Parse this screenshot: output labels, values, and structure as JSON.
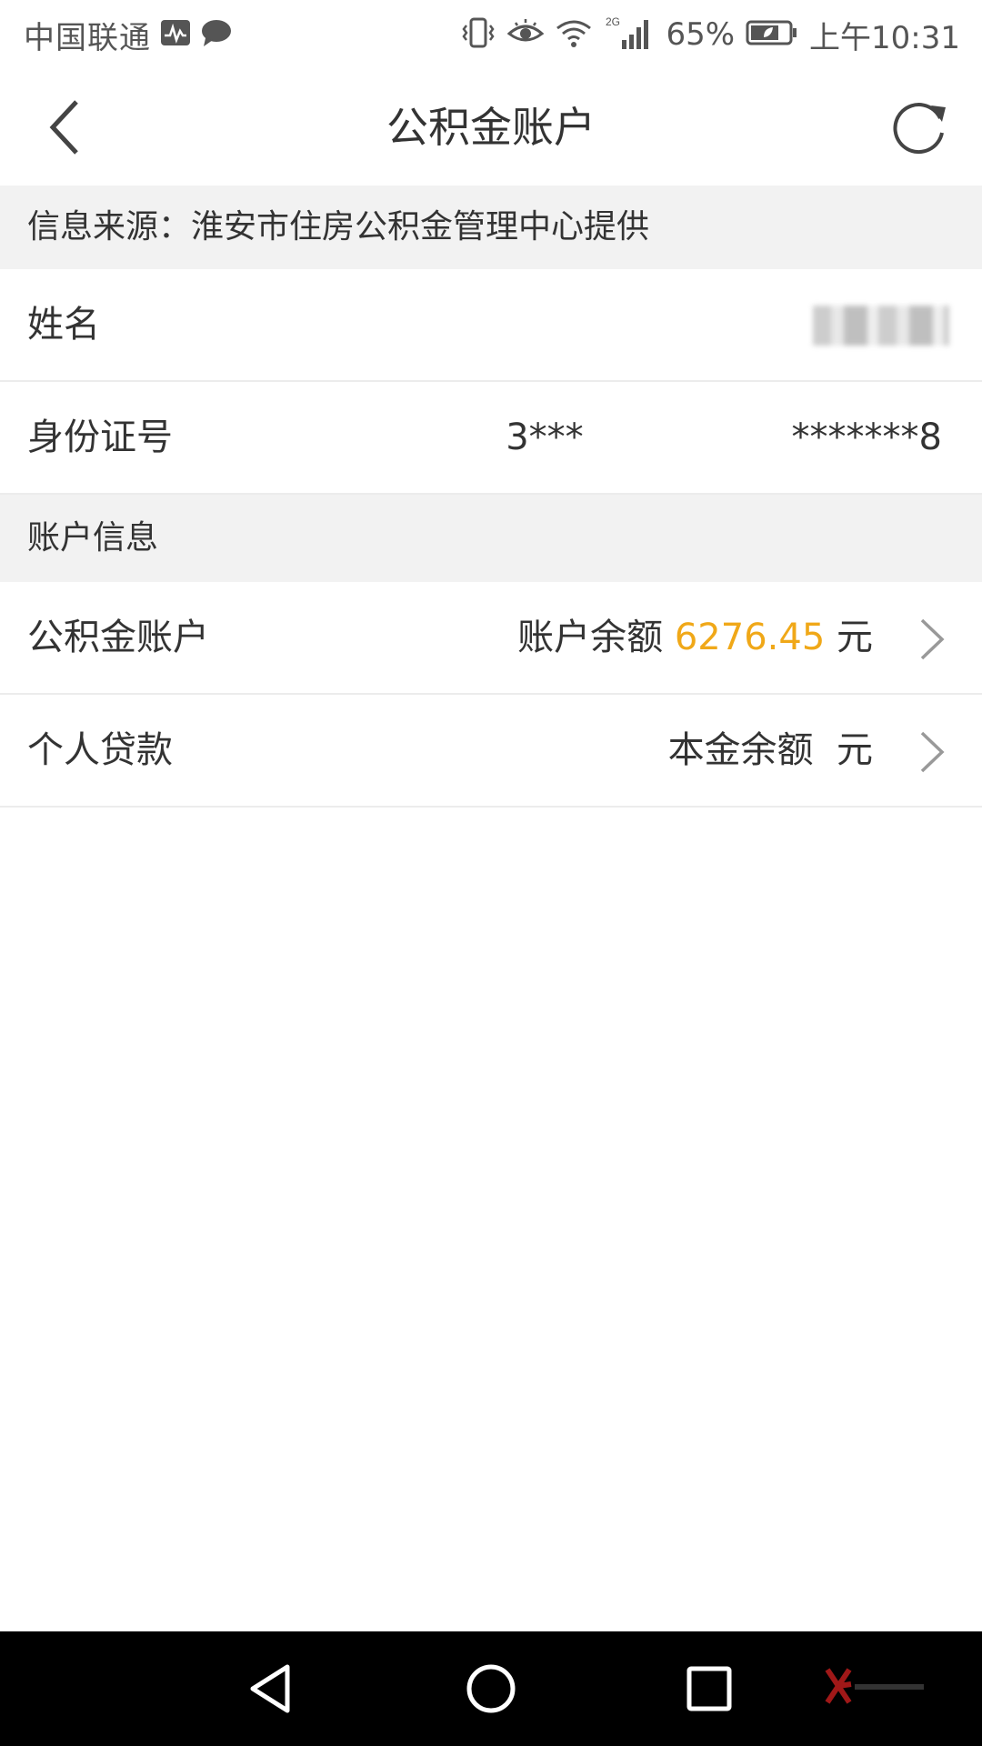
{
  "status_bar": {
    "carrier": "中国联通",
    "battery_percent": "65%",
    "network": "2G",
    "time": "上午10:31"
  },
  "header": {
    "title": "公积金账户",
    "back_icon": "chevron-left-icon",
    "refresh_icon": "refresh-icon"
  },
  "info_source": {
    "text": "信息来源：淮安市住房公积金管理中心提供"
  },
  "personal": {
    "name_label": "姓名",
    "id_label": "身份证号",
    "id_value": "3***                  *******8"
  },
  "account_section": {
    "title": "账户信息"
  },
  "accounts": [
    {
      "label": "公积金账户",
      "value_prefix": "账户余额 ",
      "amount": "6276.45",
      "unit": " 元"
    },
    {
      "label": "个人贷款",
      "value_prefix": "本金余额 ",
      "amount": "",
      "unit": " 元"
    }
  ],
  "colors": {
    "amount": "#f0a818",
    "section_bg": "#f2f2f2",
    "text": "#333333"
  }
}
